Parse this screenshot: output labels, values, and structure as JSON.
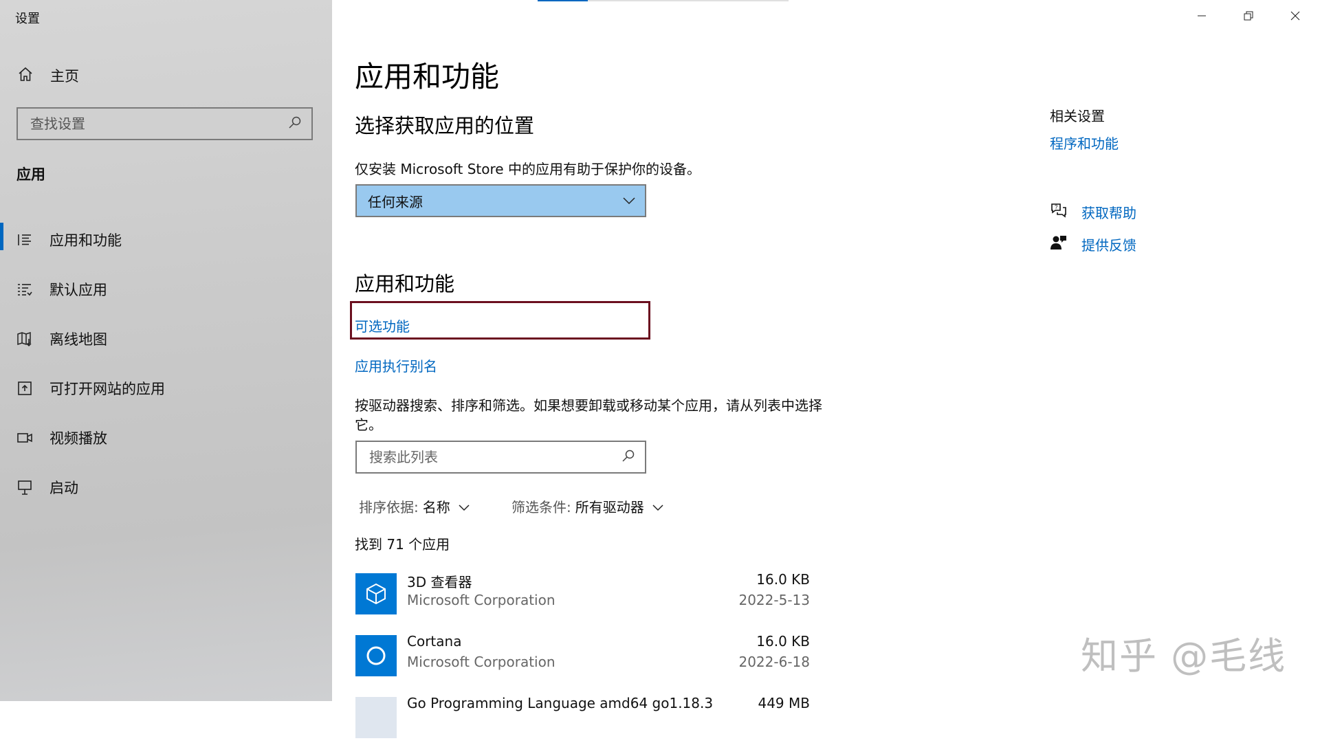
{
  "window": {
    "title": "设置",
    "controls": {
      "minimize": "minimize-icon",
      "restore": "restore-icon",
      "close": "close-icon"
    }
  },
  "sidebar": {
    "home_label": "主页",
    "search_placeholder": "查找设置",
    "section_label": "应用",
    "items": [
      {
        "label": "应用和功能",
        "icon": "apps-features-icon",
        "active": true
      },
      {
        "label": "默认应用",
        "icon": "default-apps-icon",
        "active": false
      },
      {
        "label": "离线地图",
        "icon": "offline-maps-icon",
        "active": false
      },
      {
        "label": "可打开网站的应用",
        "icon": "apps-for-websites-icon",
        "active": false
      },
      {
        "label": "视频播放",
        "icon": "video-playback-icon",
        "active": false
      },
      {
        "label": "启动",
        "icon": "startup-icon",
        "active": false
      }
    ]
  },
  "main": {
    "page_title": "应用和功能",
    "location_heading": "选择获取应用的位置",
    "location_desc": "仅安装 Microsoft Store 中的应用有助于保护你的设备。",
    "location_value": "任何来源",
    "apps_heading": "应用和功能",
    "optional_features_link": "可选功能",
    "app_alias_link": "应用执行别名",
    "search_desc": "按驱动器搜索、排序和筛选。如果想要卸载或移动某个应用，请从列表中选择它。",
    "list_search_placeholder": "搜索此列表",
    "sort_key": "排序依据:",
    "sort_value": "名称",
    "filter_key": "筛选条件:",
    "filter_value": "所有驱动器",
    "count_text": "找到 71 个应用",
    "apps": [
      {
        "name": "3D 查看器",
        "publisher": "Microsoft Corporation",
        "size": "16.0 KB",
        "date": "2022-5-13",
        "icon": "3d-viewer-icon"
      },
      {
        "name": "Cortana",
        "publisher": "Microsoft Corporation",
        "size": "16.0 KB",
        "date": "2022-6-18",
        "icon": "cortana-icon"
      },
      {
        "name": "Go Programming Language amd64 go1.18.3",
        "publisher": "",
        "size": "449 MB",
        "date": "",
        "icon": "go-app-icon"
      }
    ]
  },
  "related": {
    "title": "相关设置",
    "programs_link": "程序和功能",
    "get_help": "获取帮助",
    "feedback": "提供反馈"
  },
  "watermark": "知乎 @毛线",
  "colors": {
    "accent": "#0067c0",
    "dropdown_bg": "#99c9ef",
    "highlight_border": "#6b0f1f",
    "tile": "#0078d4"
  }
}
